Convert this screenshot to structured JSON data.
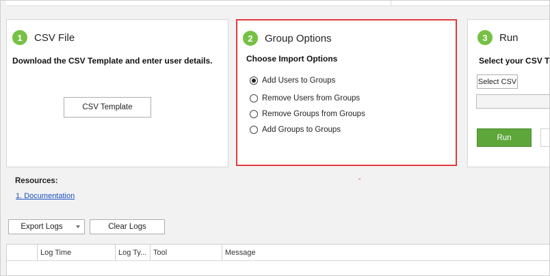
{
  "step1": {
    "number": "1",
    "title": "CSV File",
    "subtitle": "Download the CSV Template and enter user details.",
    "template_button": "CSV Template"
  },
  "step2": {
    "number": "2",
    "title": "Group Options",
    "subtitle": "Choose Import Options",
    "options": [
      {
        "label": "Add Users to Groups",
        "selected": true
      },
      {
        "label": "Remove Users from Groups",
        "selected": false
      },
      {
        "label": "Remove Groups from Groups",
        "selected": false
      },
      {
        "label": "Add Groups to Groups",
        "selected": false
      }
    ]
  },
  "step3": {
    "number": "3",
    "title": "Run",
    "subtitle": "Select your CSV Te",
    "select_button": "Select CSV",
    "file_path": "",
    "run_button": "Run"
  },
  "resources": {
    "title": "Resources:",
    "link": "1. Documentation",
    "dash": "-"
  },
  "log_toolbar": {
    "export_label": "Export Logs",
    "clear_label": "Clear Logs"
  },
  "log_grid": {
    "columns": [
      "",
      "Log Time",
      "Log Ty...",
      "Tool",
      "Message"
    ]
  },
  "colors": {
    "accent_green": "#76c043",
    "run_green": "#5ea63a",
    "highlight_red": "#e03a3a",
    "link_blue": "#1a4fc0"
  }
}
